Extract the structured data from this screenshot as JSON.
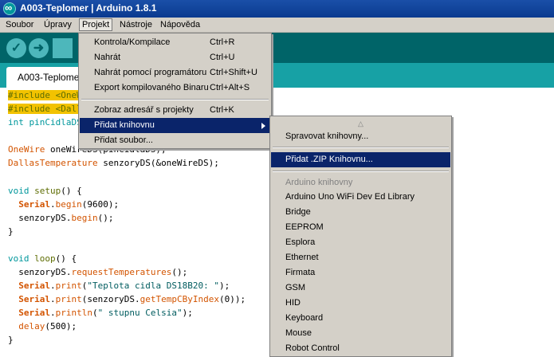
{
  "window": {
    "title": "A003-Teplomer | Arduino 1.8.1"
  },
  "menubar": {
    "items": [
      "Soubor",
      "Úpravy",
      "Projekt",
      "Nástroje",
      "Nápověda"
    ]
  },
  "toolbar": {
    "verify_symbol": "✓",
    "upload_symbol": "➜"
  },
  "tabs": {
    "active_label": "A003-Teplomer"
  },
  "code": {
    "l1_a": "#include <OneWire.h>",
    "l2_a": "#include <DallasTemperature.h>",
    "l3_a": "int pinCidlaDS = 4;",
    "l5_a": "OneWire",
    "l5_b": " oneWireDS(pinCidlaDS);",
    "l6_a": "DallasTemperature",
    "l6_b": " senzoryDS(&oneWireDS);",
    "l8_a": "void",
    "l8_b": " ",
    "l8_c": "setup",
    "l8_d": "() {",
    "l9_a": "  ",
    "l9_b": "Serial",
    "l9_c": ".",
    "l9_d": "begin",
    "l9_e": "(9600);",
    "l10_a": "  senzoryDS.",
    "l10_b": "begin",
    "l10_c": "();",
    "l11_a": "}",
    "l13_a": "void",
    "l13_b": " ",
    "l13_c": "loop",
    "l13_d": "() {",
    "l14_a": "  senzoryDS.",
    "l14_b": "requestTemperatures",
    "l14_c": "();",
    "l15_a": "  ",
    "l15_b": "Serial",
    "l15_c": ".",
    "l15_d": "print",
    "l15_e": "(",
    "l15_f": "\"Teplota cidla DS18B20: \"",
    "l15_g": ");",
    "l16_a": "  ",
    "l16_b": "Serial",
    "l16_c": ".",
    "l16_d": "print",
    "l16_e": "(senzoryDS.",
    "l16_f": "getTempCByIndex",
    "l16_g": "(0));",
    "l17_a": "  ",
    "l17_b": "Serial",
    "l17_c": ".",
    "l17_d": "println",
    "l17_e": "(",
    "l17_f": "\" stupnu Celsia\"",
    "l17_g": ");",
    "l18_a": "  ",
    "l18_b": "delay",
    "l18_c": "(500);",
    "l19_a": "}"
  },
  "projekt_menu": {
    "items": [
      {
        "label": "Kontrola/Kompilace",
        "shortcut": "Ctrl+R"
      },
      {
        "label": "Nahrát",
        "shortcut": "Ctrl+U"
      },
      {
        "label": "Nahrát pomocí programátoru",
        "shortcut": "Ctrl+Shift+U"
      },
      {
        "label": "Export kompilovaného Binaru",
        "shortcut": "Ctrl+Alt+S"
      },
      {
        "label": "Zobraz adresář s projekty",
        "shortcut": "Ctrl+K"
      },
      {
        "label": "Přidat knihovnu",
        "shortcut": ""
      },
      {
        "label": "Přidat soubor...",
        "shortcut": ""
      }
    ]
  },
  "knihovna_submenu": {
    "scroll_up": "△",
    "items": [
      "Spravovat knihovny...",
      "Přidat .ZIP Knihovnu...",
      "Arduino knihovny",
      "Arduino Uno WiFi Dev Ed Library",
      "Bridge",
      "EEPROM",
      "Esplora",
      "Ethernet",
      "Firmata",
      "GSM",
      "HID",
      "Keyboard",
      "Mouse",
      "Robot Control"
    ]
  },
  "colors": {
    "toolbar": "#006468",
    "tabstrip": "#17a1a5",
    "menu_highlight": "#0a246a",
    "include_highlight": "#f2c200"
  }
}
